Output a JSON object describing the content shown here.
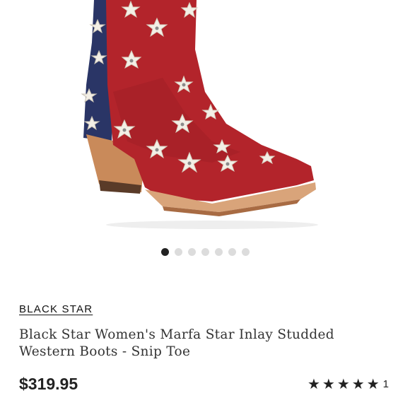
{
  "product": {
    "brand": "BLACK STAR",
    "title_line1": "Black Star Women's Marfa Star Inlay Studded",
    "title_line2": "Western Boots - Snip Toe",
    "price": "$319.95",
    "rating_stars": 5,
    "review_count": "1",
    "image_icon": "western-boot-image"
  },
  "gallery": {
    "total_images": 7,
    "active_index": 0
  },
  "colors": {
    "boot_red": "#b3242b",
    "boot_blue": "#2a3566",
    "heel_wood": "#c98a5a",
    "star_white": "#f3efe6",
    "dot_active": "#222222",
    "dot_inactive": "#dcdcdc"
  }
}
